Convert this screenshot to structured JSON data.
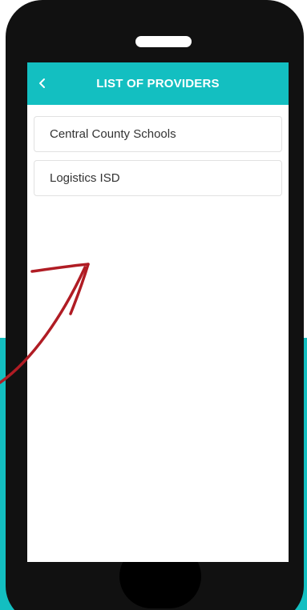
{
  "header": {
    "title": "LIST OF PROVIDERS",
    "back_icon": "chevron-left-icon"
  },
  "providers": [
    {
      "label": "Central County Schools"
    },
    {
      "label": "Logistics ISD"
    }
  ],
  "colors": {
    "accent": "#13bfc1",
    "phone_body": "#111111",
    "annotation_arrow": "#b01c24"
  }
}
